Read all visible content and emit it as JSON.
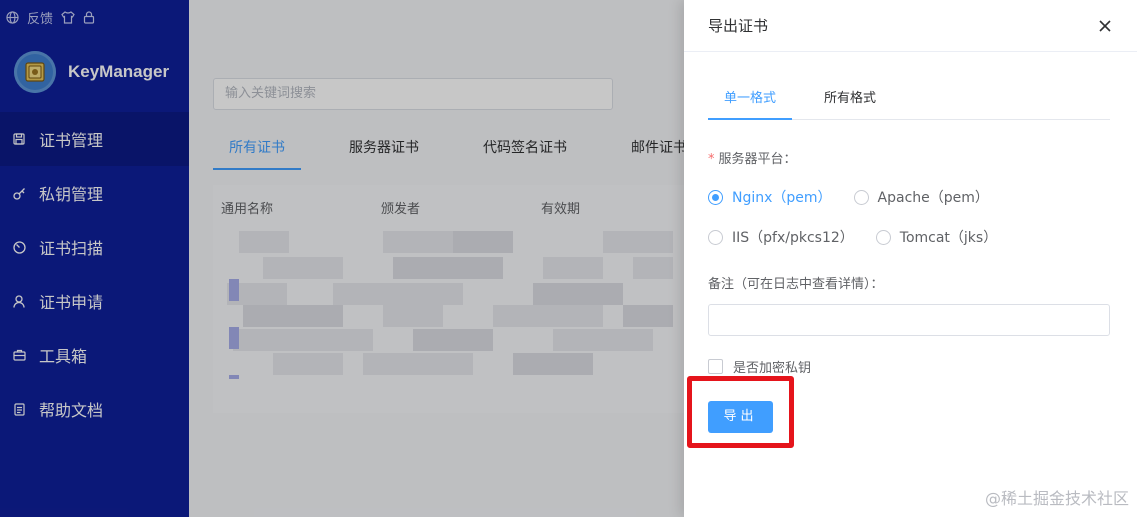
{
  "topbar": {
    "feedback": "反馈"
  },
  "brand": {
    "name": "KeyManager"
  },
  "sidebar": {
    "items": [
      {
        "label": "证书管理",
        "icon": "save-icon"
      },
      {
        "label": "私钥管理",
        "icon": "key-icon"
      },
      {
        "label": "证书扫描",
        "icon": "scan-icon"
      },
      {
        "label": "证书申请",
        "icon": "user-icon"
      },
      {
        "label": "工具箱",
        "icon": "toolbox-icon"
      },
      {
        "label": "帮助文档",
        "icon": "document-icon"
      }
    ]
  },
  "main": {
    "search": {
      "placeholder": "输入关键词搜索"
    },
    "tabs": [
      "所有证书",
      "服务器证书",
      "代码签名证书",
      "邮件证书"
    ],
    "table": {
      "columns": [
        "通用名称",
        "颁发者",
        "有效期"
      ]
    }
  },
  "drawer": {
    "title": "导出证书",
    "tabs": [
      "单一格式",
      "所有格式"
    ],
    "platform_label": "服务器平台：",
    "platform_options": [
      {
        "label": "Nginx（pem）",
        "checked": true
      },
      {
        "label": "Apache（pem）",
        "checked": false
      },
      {
        "label": "IIS（pfx/pkcs12）",
        "checked": false
      },
      {
        "label": "Tomcat（jks）",
        "checked": false
      }
    ],
    "note_label": "备注（可在日志中查看详情）：",
    "note_value": "",
    "encrypt_label": "是否加密私钥",
    "encrypt_checked": false,
    "export_label": "导出"
  },
  "watermark": "@稀土掘金技术社区",
  "colors": {
    "sidebar": "#0f1f9a",
    "primary": "#409eff",
    "highlight": "#e5141b"
  }
}
